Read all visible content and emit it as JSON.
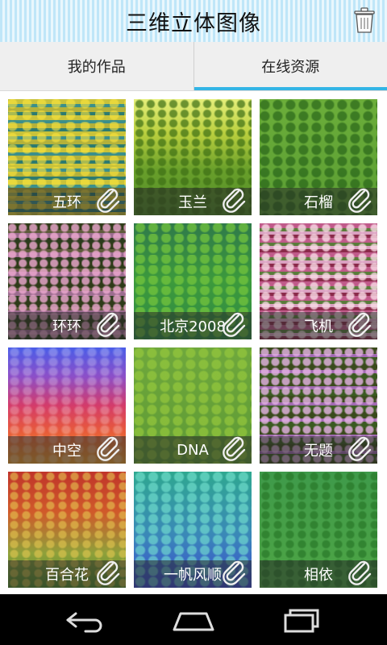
{
  "app": {
    "title": "三维立体图像"
  },
  "tabs": [
    {
      "label": "我的作品",
      "selected": false
    },
    {
      "label": "在线资源",
      "selected": true
    }
  ],
  "tiles": [
    {
      "caption": "五环"
    },
    {
      "caption": "玉兰"
    },
    {
      "caption": "石榴"
    },
    {
      "caption": "环环"
    },
    {
      "caption": "北京2008"
    },
    {
      "caption": "飞机"
    },
    {
      "caption": "中空"
    },
    {
      "caption": "DNA"
    },
    {
      "caption": "无题"
    },
    {
      "caption": "百合花"
    },
    {
      "caption": "一帆风顺"
    },
    {
      "caption": "相依"
    }
  ],
  "icons": {
    "trash": "trash-icon",
    "clip": "paperclip-icon",
    "back": "back-icon",
    "home": "home-icon",
    "recents": "recents-icon"
  },
  "colors": {
    "accent": "#33b5e5"
  }
}
